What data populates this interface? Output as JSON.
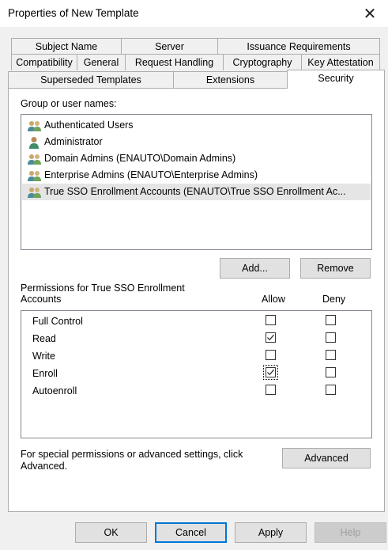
{
  "window": {
    "title": "Properties of New Template",
    "close_glyph": "✕"
  },
  "tabs": {
    "row1": [
      "Subject Name",
      "Server",
      "Issuance Requirements"
    ],
    "row2": [
      "Compatibility",
      "General",
      "Request Handling",
      "Cryptography",
      "Key Attestation"
    ],
    "row3": [
      "Superseded Templates",
      "Extensions",
      "Security"
    ],
    "active": "Security"
  },
  "security": {
    "group_label": "Group or user names:",
    "users": [
      {
        "name": "Authenticated Users",
        "icon": "group-icon"
      },
      {
        "name": "Administrator",
        "icon": "user-icon"
      },
      {
        "name": "Domain Admins (ENAUTO\\Domain Admins)",
        "icon": "group-icon"
      },
      {
        "name": "Enterprise Admins (ENAUTO\\Enterprise Admins)",
        "icon": "group-icon"
      },
      {
        "name": "True SSO Enrollment Accounts (ENAUTO\\True SSO Enrollment Ac...",
        "icon": "group-icon",
        "selected": true
      }
    ],
    "add_label": "Add...",
    "remove_label": "Remove",
    "perm_label_line1": "Permissions for True SSO Enrollment",
    "perm_label_line2": "Accounts",
    "allow_header": "Allow",
    "deny_header": "Deny",
    "permissions": [
      {
        "name": "Full Control",
        "allow": false,
        "deny": false
      },
      {
        "name": "Read",
        "allow": true,
        "deny": false
      },
      {
        "name": "Write",
        "allow": false,
        "deny": false
      },
      {
        "name": "Enroll",
        "allow": true,
        "deny": false,
        "focused": true
      },
      {
        "name": "Autoenroll",
        "allow": false,
        "deny": false
      }
    ],
    "special_line1": "For special permissions or advanced settings, click",
    "special_line2": "Advanced.",
    "advanced_label": "Advanced"
  },
  "footer": {
    "ok": "OK",
    "cancel": "Cancel",
    "apply": "Apply",
    "help": "Help"
  },
  "colors": {
    "accent": "#0078d7",
    "selected_row": "#e5e5e5"
  }
}
